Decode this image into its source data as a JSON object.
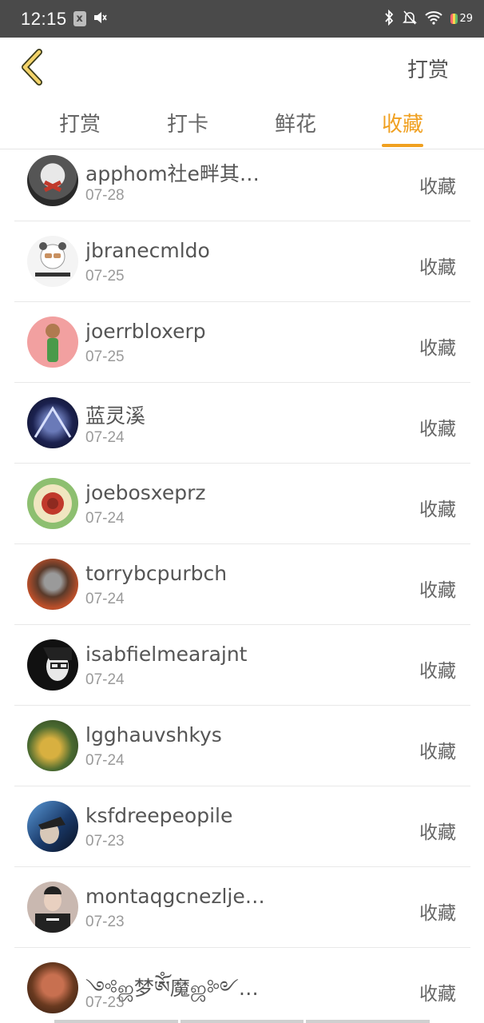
{
  "status_bar": {
    "time": "12:15",
    "notification_glyph": "x",
    "battery_level": "29",
    "icons": [
      "mute-icon",
      "bluetooth-icon",
      "bell-off-icon",
      "wifi-icon",
      "battery-icon"
    ]
  },
  "header": {
    "back_icon": "chevron-left-icon",
    "action_label": "打赏"
  },
  "tabs": [
    {
      "label": "打赏",
      "active": false
    },
    {
      "label": "打卡",
      "active": false
    },
    {
      "label": "鲜花",
      "active": false
    },
    {
      "label": "收藏",
      "active": true
    }
  ],
  "list": [
    {
      "name": "apphom社e畔其…",
      "date": "07-28",
      "action": "收藏"
    },
    {
      "name": "jbranecmldo",
      "date": "07-25",
      "action": "收藏"
    },
    {
      "name": "joerrbloxerp",
      "date": "07-25",
      "action": "收藏"
    },
    {
      "name": "蓝灵溪",
      "date": "07-24",
      "action": "收藏"
    },
    {
      "name": "joebosxeprz",
      "date": "07-24",
      "action": "收藏"
    },
    {
      "name": "torrybcpurbch",
      "date": "07-24",
      "action": "收藏"
    },
    {
      "name": "isabfielmearajnt",
      "date": "07-24",
      "action": "收藏"
    },
    {
      "name": "lgghauvshkys",
      "date": "07-24",
      "action": "收藏"
    },
    {
      "name": "ksfdreepeopile",
      "date": "07-23",
      "action": "收藏"
    },
    {
      "name": "montaqgcnezlje…",
      "date": "07-23",
      "action": "收藏"
    },
    {
      "name": "༺ஜ梦ༀ魔ஜ༻…",
      "date": "07-23",
      "action": "收藏"
    }
  ],
  "colors": {
    "accent": "#f0a020",
    "status_bar_bg": "#4a4a4a",
    "divider": "#e8e8e8"
  }
}
